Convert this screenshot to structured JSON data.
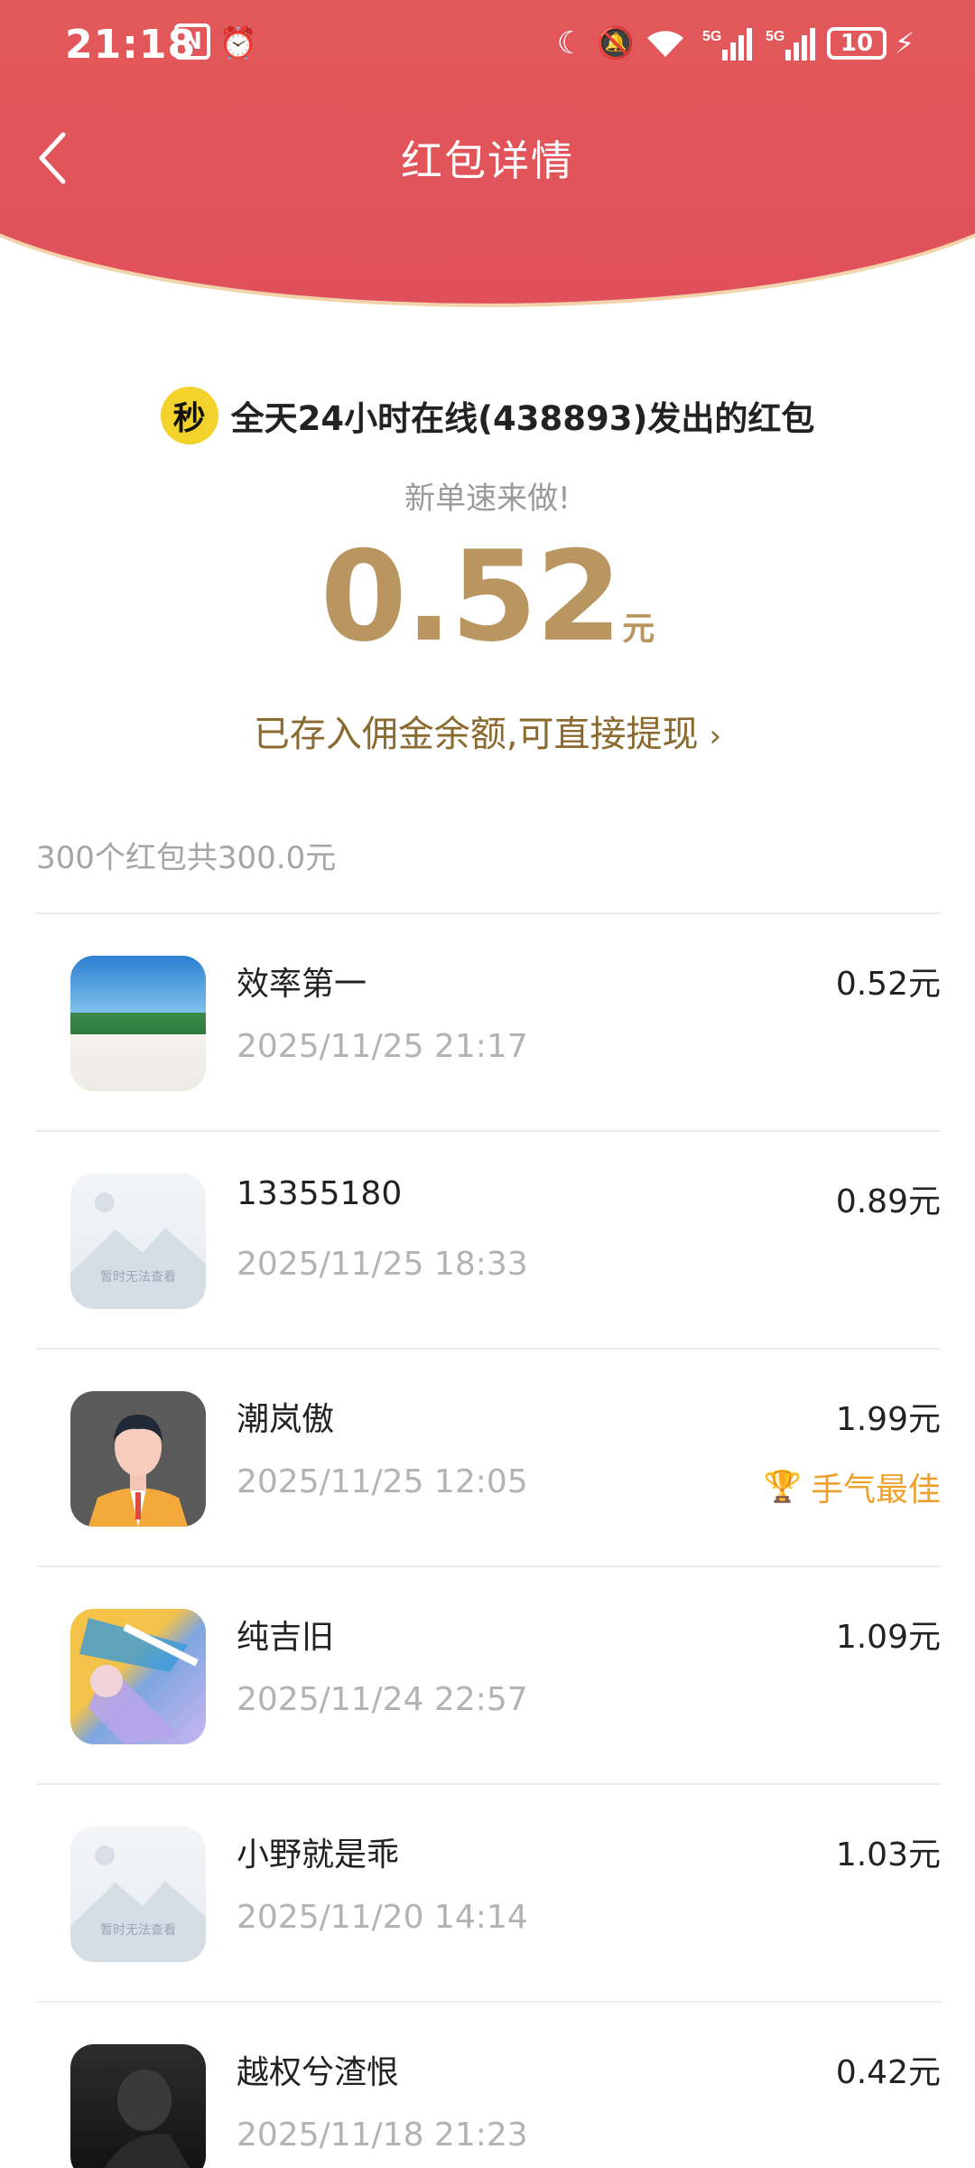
{
  "status_bar": {
    "time": "21:18",
    "battery": "10"
  },
  "header": {
    "title": "红包详情"
  },
  "sender": {
    "logo_text": "秒",
    "text": "全天24小时在线(438893)发出的红包",
    "greeting": "新单速来做!",
    "amount": "0.52",
    "unit": "元",
    "notice": "已存入佣金余额,可直接提现"
  },
  "summary": "300个红包共300.0元",
  "placeholder_caption": "暂时无法查看",
  "list": [
    {
      "name": "效率第一",
      "date": "2025/11/25 21:17",
      "value": "0.52元",
      "avatar": "beach-avatar"
    },
    {
      "name": "13355180",
      "date": "2025/11/25 18:33",
      "value": "0.89元",
      "avatar": "placeholder-avatar"
    },
    {
      "name": "潮岚傲",
      "date": "2025/11/25 12:05",
      "value": "1.99元",
      "avatar": "user-avatar",
      "badge": "手气最佳"
    },
    {
      "name": "纯吉旧",
      "date": "2025/11/24 22:57",
      "value": "1.09元",
      "avatar": "anime-avatar"
    },
    {
      "name": "小野就是乖",
      "date": "2025/11/20 14:14",
      "value": "1.03元",
      "avatar": "placeholder-avatar"
    },
    {
      "name": "越权兮渣恨",
      "date": "2025/11/18 21:23",
      "value": "0.42元",
      "avatar": "dark-avatar"
    }
  ],
  "colors": {
    "header": "#e0505a",
    "gold": "#b9955f",
    "best": "#efa12e"
  }
}
